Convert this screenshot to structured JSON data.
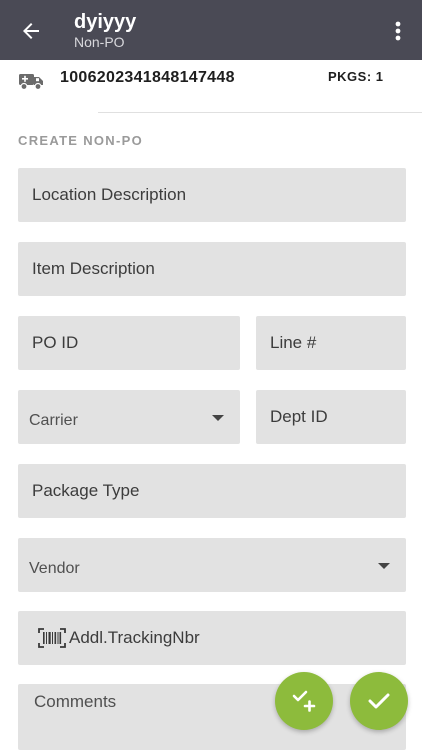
{
  "header": {
    "title": "dyiyyy",
    "subtitle": "Non-PO",
    "back_icon": "arrow-left-icon",
    "menu_icon": "more-vertical-icon",
    "background_color": "#4a4a55"
  },
  "shipment": {
    "icon": "truck-icon",
    "tracking_number": "1006202341848147448",
    "pkgs_label": "PKGS: 1"
  },
  "form": {
    "section_title": "CREATE NON-PO",
    "location_description": {
      "placeholder": "Location Description",
      "value": ""
    },
    "item_description": {
      "placeholder": "Item Description",
      "value": ""
    },
    "po_id": {
      "placeholder": "PO ID",
      "value": ""
    },
    "line_number": {
      "placeholder": "Line #",
      "value": ""
    },
    "carrier": {
      "placeholder": "Carrier",
      "selected": ""
    },
    "dept_id": {
      "placeholder": "Dept ID",
      "value": ""
    },
    "package_type": {
      "placeholder": "Package Type",
      "value": ""
    },
    "vendor": {
      "placeholder": "Vendor",
      "selected": ""
    },
    "addl_tracking": {
      "placeholder": "Addl.TrackingNbr",
      "icon": "barcode-icon",
      "value": ""
    },
    "comments": {
      "placeholder": "Comments",
      "value": ""
    }
  },
  "actions": {
    "add_check_icon": "check-plus-icon",
    "submit_icon": "check-icon",
    "fab_color": "#8dbb3c"
  }
}
